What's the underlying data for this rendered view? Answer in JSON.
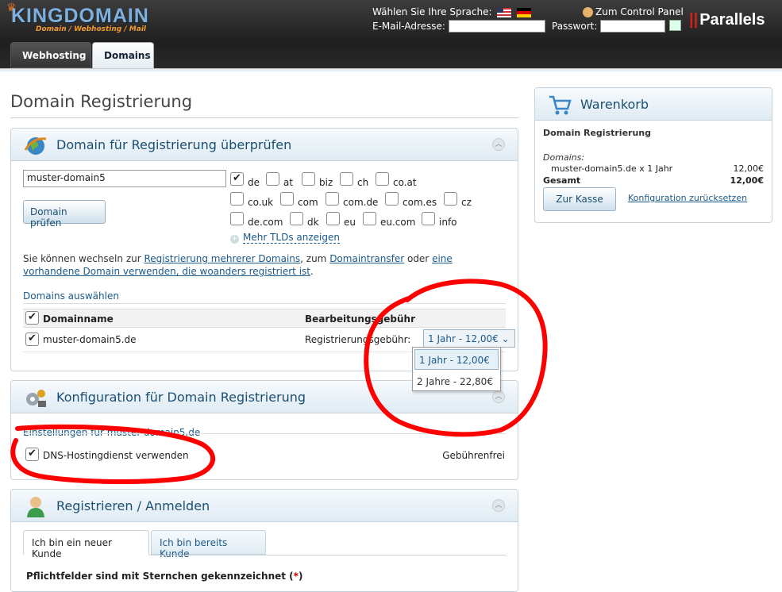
{
  "header": {
    "logo_text": "KINGDOMAIN",
    "logo_subtitle": "Domain / Webhosting / Mail",
    "language_label": "Wählen Sie Ihre Sprache:",
    "email_label": "E-Mail-Adresse:",
    "password_label": "Passwort:",
    "control_panel_label": "Zum Control Panel",
    "parallels_label": "Parallels"
  },
  "tabs": [
    {
      "label": "Webhosting",
      "active": false
    },
    {
      "label": "Domains",
      "active": true
    }
  ],
  "page": {
    "title": "Domain Registrierung"
  },
  "check_panel": {
    "title": "Domain für Registrierung überprüfen",
    "domain_value": "muster-domain5",
    "check_button": "Domain prüfen",
    "tlds": [
      {
        "label": "de",
        "checked": true
      },
      {
        "label": "at",
        "checked": false
      },
      {
        "label": "biz",
        "checked": false
      },
      {
        "label": "ch",
        "checked": false
      },
      {
        "label": "co.at",
        "checked": false
      },
      {
        "label": "co.uk",
        "checked": false
      },
      {
        "label": "com",
        "checked": false
      },
      {
        "label": "com.de",
        "checked": false
      },
      {
        "label": "com.es",
        "checked": false
      },
      {
        "label": "cz",
        "checked": false
      },
      {
        "label": "de.com",
        "checked": false
      },
      {
        "label": "dk",
        "checked": false
      },
      {
        "label": "eu",
        "checked": false
      },
      {
        "label": "eu.com",
        "checked": false
      },
      {
        "label": "info",
        "checked": false
      }
    ],
    "more_tlds": "Mehr TLDs anzeigen",
    "info_text_1": "Sie können wechseln zur ",
    "info_link_1": "Registrierung mehrerer Domains",
    "info_text_2": ", zum ",
    "info_link_2": "Domaintransfer",
    "info_text_3": " oder ",
    "info_link_3": "eine vorhandene Domain verwenden, die woanders registriert ist",
    "info_text_4": ".",
    "select_title": "Domains auswählen",
    "col_domain": "Domainname",
    "col_fee": "Bearbeitungsgebühr",
    "row_domain": "muster-domain5.de",
    "row_fee_label": "Registrierungsgebühr:",
    "period_selected": "1 Jahr - 12,00€",
    "period_options": [
      "1 Jahr - 12,00€",
      "2 Jahre - 22,80€"
    ]
  },
  "config_panel": {
    "title": "Konfiguration für Domain Registrierung",
    "settings_title": "Einstellungen für muster-domain5.de",
    "dns_label": "DNS-Hostingdienst verwenden",
    "dns_checked": true,
    "dns_fee": "Gebührenfrei"
  },
  "register_panel": {
    "title": "Registrieren / Anmelden",
    "tab_new": "Ich bin ein neuer Kunde",
    "tab_existing": "Ich bin bereits Kunde",
    "required_note": "Pflichtfelder sind mit Sternchen gekennzeichnet (",
    "required_star": "*",
    "required_close": ")"
  },
  "cart": {
    "title": "Warenkorb",
    "subtitle": "Domain Registrierung",
    "domains_label": "Domains:",
    "item": "muster-domain5.de x 1 Jahr",
    "item_price": "12,00€",
    "total_label": "Gesamt",
    "total_price": "12,00€",
    "checkout_button": "Zur Kasse",
    "reset_link": "Konfiguration zurücksetzen"
  },
  "colors": {
    "accent": "#1b5a8a",
    "annotation": "#ff0000"
  }
}
